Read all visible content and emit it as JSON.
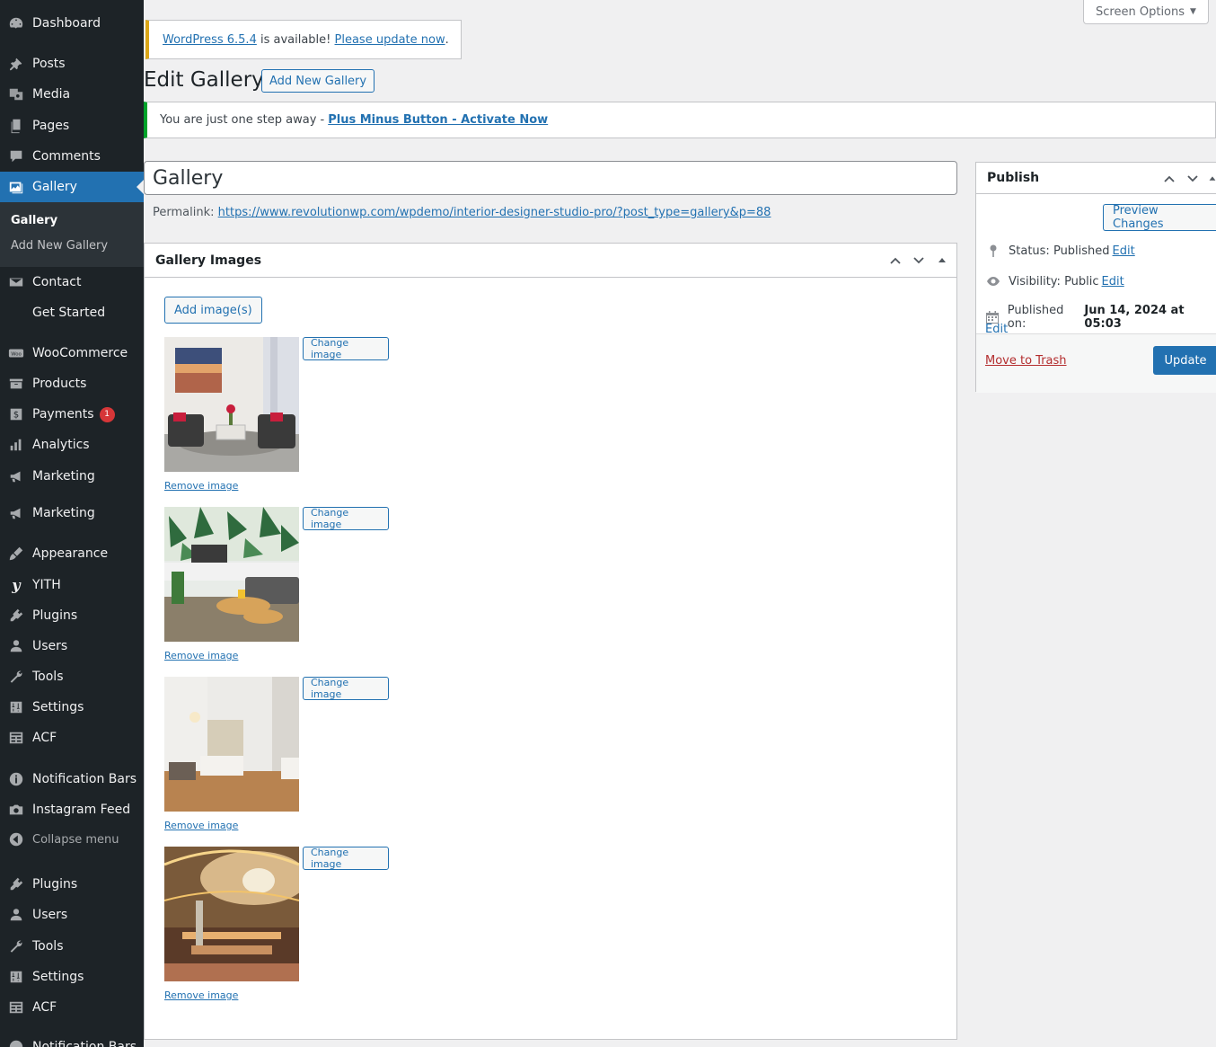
{
  "sidebar": {
    "items": [
      {
        "label": "Dashboard",
        "icon": "dashboard-icon"
      },
      {
        "label": "Posts",
        "icon": "pin-icon"
      },
      {
        "label": "Media",
        "icon": "media-icon"
      },
      {
        "label": "Pages",
        "icon": "page-icon"
      },
      {
        "label": "Comments",
        "icon": "comment-icon"
      },
      {
        "label": "Gallery",
        "icon": "gallery-icon"
      },
      {
        "label": "Contact",
        "icon": "mail-icon"
      },
      {
        "label": "Get Started",
        "icon": ""
      },
      {
        "label": "WooCommerce",
        "icon": "woo-icon"
      },
      {
        "label": "Products",
        "icon": "archive-icon"
      },
      {
        "label": "Payments",
        "icon": "payment-icon"
      },
      {
        "label": "Analytics",
        "icon": "chart-icon"
      },
      {
        "label": "Marketing",
        "icon": "megaphone-icon"
      },
      {
        "label": "Marketing",
        "icon": "megaphone-icon"
      },
      {
        "label": "Appearance",
        "icon": "brush-icon"
      },
      {
        "label": "YITH",
        "icon": "yith-icon"
      },
      {
        "label": "Plugins",
        "icon": "plugin-icon"
      },
      {
        "label": "Users",
        "icon": "user-icon"
      },
      {
        "label": "Tools",
        "icon": "wrench-icon"
      },
      {
        "label": "Settings",
        "icon": "settings-icon"
      },
      {
        "label": "ACF",
        "icon": "acf-icon"
      },
      {
        "label": "Notification Bars",
        "icon": "info-icon"
      },
      {
        "label": "Instagram Feed",
        "icon": "camera-icon"
      },
      {
        "label": "Collapse menu",
        "icon": "collapse-icon"
      },
      {
        "label": "Plugins",
        "icon": "plugin-icon"
      },
      {
        "label": "Users",
        "icon": "user-icon"
      },
      {
        "label": "Tools",
        "icon": "wrench-icon"
      },
      {
        "label": "Settings",
        "icon": "settings-icon"
      },
      {
        "label": "ACF",
        "icon": "acf-icon"
      },
      {
        "label": "Notification Bars",
        "icon": "info-icon"
      }
    ],
    "submenu": {
      "current": "Gallery",
      "add_new": "Add New Gallery"
    },
    "payments_badge": "1"
  },
  "screen_options": {
    "label": "Screen Options",
    "arrow": "▼"
  },
  "update_nag": {
    "version_link": "WordPress 6.5.4",
    "middle_text": " is available! ",
    "update_link": "Please update now",
    "end_text": "."
  },
  "page": {
    "title": "Edit Gallery",
    "add_new_label": "Add New Gallery"
  },
  "notice": {
    "text": "You are just one step away -",
    "link": "Plus Minus Button - Activate Now"
  },
  "post": {
    "title_value": "Gallery",
    "permalink_label": "Permalink:",
    "permalink_url": "https://www.revolutionwp.com/wpdemo/interior-designer-studio-pro/?post_type=gallery&p=88"
  },
  "gallery_box": {
    "title": "Gallery Images",
    "add_images_label": "Add image(s)",
    "change_label": "Change image",
    "remove_label": "Remove image",
    "images": [
      {
        "alt": "living room with painting and armchairs"
      },
      {
        "alt": "tropical wallpaper lounge"
      },
      {
        "alt": "hotel bedroom"
      },
      {
        "alt": "mall atrium with chandelier"
      }
    ]
  },
  "publish": {
    "title": "Publish",
    "preview_label": "Preview Changes",
    "status_label": "Status:",
    "status_value": "Published",
    "visibility_label": "Visibility:",
    "visibility_value": "Public",
    "published_label": "Published on:",
    "published_value": "Jun 14, 2024 at 05:03",
    "edit_label": "Edit",
    "trash_label": "Move to Trash",
    "update_label": "Update"
  },
  "colors": {
    "sidebar_bg": "#1d2327",
    "accent": "#2271b1",
    "notice_success": "#00a32a",
    "notice_warning": "#dba617",
    "trash": "#b32d2e"
  }
}
